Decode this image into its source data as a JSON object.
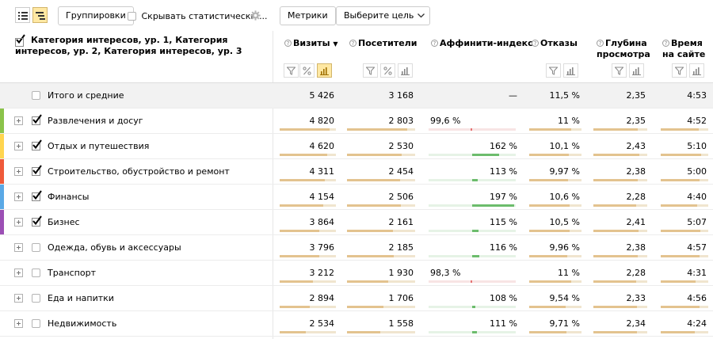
{
  "toolbar": {
    "groupings_label": "Группировки",
    "hide_stats_label": "Скрывать статистически ...",
    "metrics_label": "Метрики",
    "goal_label": "Выберите цель"
  },
  "header": {
    "dimension_title": "Категория интересов, ур. 1, Категория интересов, ур. 2, Категория интересов, ур. 3",
    "columns": [
      {
        "line1": "Визиты",
        "line2": "",
        "sort": "▼"
      },
      {
        "line1": "Посетители",
        "line2": ""
      },
      {
        "line1": "Аффинити-индекс",
        "line2": ""
      },
      {
        "line1": "Отказы",
        "line2": ""
      },
      {
        "line1": "Глубина",
        "line2": "просмотра"
      },
      {
        "line1": "Время",
        "line2": "на сайте"
      }
    ]
  },
  "totals": {
    "label": "Итого и средние",
    "visits": "5 426",
    "visitors": "3 168",
    "affinity": "—",
    "bounce": "11,5 %",
    "depth": "2,35",
    "time": "4:53"
  },
  "rows": [
    {
      "label": "Развлечения и досуг",
      "checked": true,
      "color": "#8bc34a",
      "visits": "4 820",
      "visitors": "2 803",
      "affinity": "99,6 %",
      "affinity_value": 99.6,
      "bounce": "11 %",
      "depth": "2,35",
      "time": "4:52",
      "visits_share": 0.89,
      "visitors_share": 0.885,
      "bounce_share": 0.8,
      "depth_share": 0.82,
      "time_share": 0.8
    },
    {
      "label": "Отдых и путешествия",
      "checked": true,
      "color": "#ffd54f",
      "visits": "4 620",
      "visitors": "2 530",
      "affinity": "162 %",
      "affinity_value": 162,
      "bounce": "10,1 %",
      "depth": "2,43",
      "time": "5:10",
      "visits_share": 0.85,
      "visitors_share": 0.8,
      "bounce_share": 0.75,
      "depth_share": 0.85,
      "time_share": 0.85
    },
    {
      "label": "Строительство, обустройство и ремонт",
      "checked": true,
      "color": "#ef5a3a",
      "visits": "4 311",
      "visitors": "2 454",
      "affinity": "113 %",
      "affinity_value": 113,
      "bounce": "9,97 %",
      "depth": "2,38",
      "time": "5:00",
      "visits_share": 0.8,
      "visitors_share": 0.775,
      "bounce_share": 0.74,
      "depth_share": 0.83,
      "time_share": 0.82
    },
    {
      "label": "Финансы",
      "checked": true,
      "color": "#5aa9e6",
      "visits": "4 154",
      "visitors": "2 506",
      "affinity": "197 %",
      "affinity_value": 197,
      "bounce": "10,6 %",
      "depth": "2,28",
      "time": "4:40",
      "visits_share": 0.77,
      "visitors_share": 0.79,
      "bounce_share": 0.78,
      "depth_share": 0.79,
      "time_share": 0.77
    },
    {
      "label": "Бизнес",
      "checked": true,
      "color": "#9c4fb5",
      "visits": "3 864",
      "visitors": "2 161",
      "affinity": "115 %",
      "affinity_value": 115,
      "bounce": "10,5 %",
      "depth": "2,41",
      "time": "5:07",
      "visits_share": 0.71,
      "visitors_share": 0.68,
      "bounce_share": 0.77,
      "depth_share": 0.84,
      "time_share": 0.84
    },
    {
      "label": "Одежда, обувь и аксессуары",
      "checked": false,
      "color": "",
      "visits": "3 796",
      "visitors": "2 185",
      "affinity": "116 %",
      "affinity_value": 116,
      "bounce": "9,96 %",
      "depth": "2,38",
      "time": "4:57",
      "visits_share": 0.7,
      "visitors_share": 0.69,
      "bounce_share": 0.73,
      "depth_share": 0.83,
      "time_share": 0.81
    },
    {
      "label": "Транспорт",
      "checked": false,
      "color": "",
      "visits": "3 212",
      "visitors": "1 930",
      "affinity": "98,3 %",
      "affinity_value": 98.3,
      "bounce": "11 %",
      "depth": "2,28",
      "time": "4:31",
      "visits_share": 0.59,
      "visitors_share": 0.61,
      "bounce_share": 0.8,
      "depth_share": 0.79,
      "time_share": 0.74
    },
    {
      "label": "Еда и напитки",
      "checked": false,
      "color": "",
      "visits": "2 894",
      "visitors": "1 706",
      "affinity": "108 %",
      "affinity_value": 108,
      "bounce": "9,54 %",
      "depth": "2,33",
      "time": "4:56",
      "visits_share": 0.53,
      "visitors_share": 0.54,
      "bounce_share": 0.7,
      "depth_share": 0.81,
      "time_share": 0.81
    },
    {
      "label": "Недвижимость",
      "checked": false,
      "color": "",
      "visits": "2 534",
      "visitors": "1 558",
      "affinity": "111 %",
      "affinity_value": 111,
      "bounce": "9,71 %",
      "depth": "2,34",
      "time": "4:24",
      "visits_share": 0.47,
      "visitors_share": 0.49,
      "bounce_share": 0.71,
      "depth_share": 0.81,
      "time_share": 0.72
    }
  ]
}
